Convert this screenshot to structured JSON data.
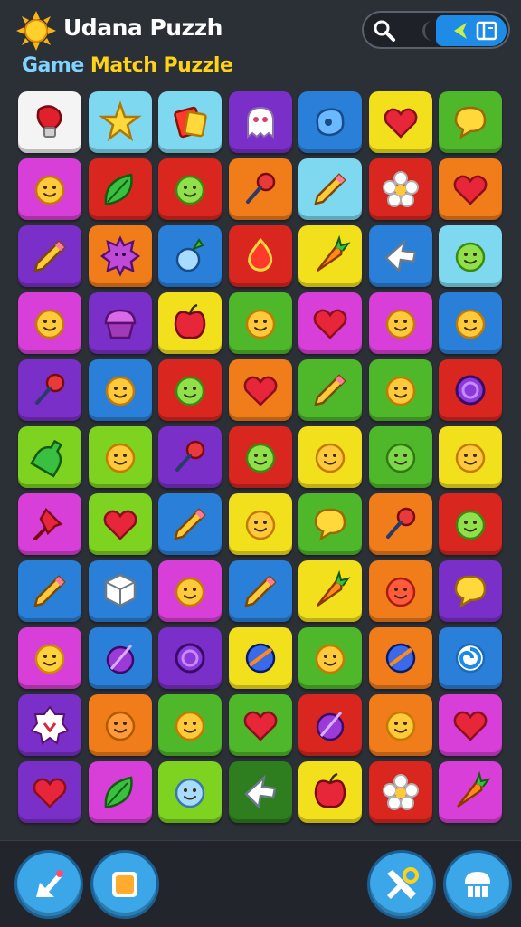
{
  "header": {
    "app_title": "Udana Puzzh",
    "subtitle_word1": "Game",
    "subtitle_word2": "Match Puzzle",
    "logo_icon": "sun-icon",
    "controls": {
      "search_icon": "search-icon",
      "toggle_icon": "moon-icon",
      "active_icons": [
        "arrow-icon",
        "book-icon"
      ]
    }
  },
  "colors": {
    "white": "#f4f4f4",
    "cyan": "#7dd8f0",
    "purple": "#7b2fc9",
    "blue": "#2a7fd8",
    "yellow": "#f2e01c",
    "green": "#4fb82a",
    "magenta": "#d83fd8",
    "red": "#d9271f",
    "orange": "#f07c1a",
    "lime": "#7ed321",
    "pink": "#f05ab4",
    "darkgreen": "#2e7d1e",
    "mint": "#8fe0d0"
  },
  "board": {
    "rows": [
      [
        {
          "bg": "white",
          "icon": "boxing-glove-icon"
        },
        {
          "bg": "cyan",
          "icon": "star-creature-icon"
        },
        {
          "bg": "cyan",
          "icon": "card-icon"
        },
        {
          "bg": "purple",
          "icon": "ghost-face-icon"
        },
        {
          "bg": "blue",
          "icon": "blob-icon"
        },
        {
          "bg": "yellow",
          "icon": "heart-icon"
        },
        {
          "bg": "green",
          "icon": "speech-bubble-icon"
        }
      ],
      [
        {
          "bg": "magenta",
          "icon": "smiley-face-icon"
        },
        {
          "bg": "red",
          "icon": "leaf-icon"
        },
        {
          "bg": "red",
          "icon": "green-smiley-icon"
        },
        {
          "bg": "orange",
          "icon": "pin-icon"
        },
        {
          "bg": "cyan",
          "icon": "pencil-icon"
        },
        {
          "bg": "red",
          "icon": "flower-icon"
        },
        {
          "bg": "orange",
          "icon": "heart-icon"
        }
      ],
      [
        {
          "bg": "purple",
          "icon": "pencil-icon"
        },
        {
          "bg": "orange",
          "icon": "gear-creature-icon"
        },
        {
          "bg": "blue",
          "icon": "turnip-icon"
        },
        {
          "bg": "red",
          "icon": "drop-icon"
        },
        {
          "bg": "yellow",
          "icon": "carrot-icon"
        },
        {
          "bg": "blue",
          "icon": "arrow-icon"
        },
        {
          "bg": "cyan",
          "icon": "green-smiley-icon"
        }
      ],
      [
        {
          "bg": "magenta",
          "icon": "smiley-face-icon"
        },
        {
          "bg": "purple",
          "icon": "cupcake-icon"
        },
        {
          "bg": "yellow",
          "icon": "apple-icon"
        },
        {
          "bg": "green",
          "icon": "smiley-face-icon"
        },
        {
          "bg": "magenta",
          "icon": "heart-icon"
        },
        {
          "bg": "magenta",
          "icon": "smiley-face-icon"
        },
        {
          "bg": "blue",
          "icon": "smiley-face-icon"
        }
      ],
      [
        {
          "bg": "purple",
          "icon": "pin-icon"
        },
        {
          "bg": "blue",
          "icon": "smiley-face-icon"
        },
        {
          "bg": "red",
          "icon": "green-smiley-icon"
        },
        {
          "bg": "orange",
          "icon": "heart-icon"
        },
        {
          "bg": "green",
          "icon": "pencil-icon"
        },
        {
          "bg": "green",
          "icon": "smiley-face-icon"
        },
        {
          "bg": "red",
          "icon": "ring-icon"
        }
      ],
      [
        {
          "bg": "lime",
          "icon": "bottle-icon"
        },
        {
          "bg": "lime",
          "icon": "winking-face-icon"
        },
        {
          "bg": "purple",
          "icon": "pin-icon"
        },
        {
          "bg": "red",
          "icon": "green-smiley-icon"
        },
        {
          "bg": "yellow",
          "icon": "smiley-face-icon"
        },
        {
          "bg": "green",
          "icon": "zombie-face-icon"
        },
        {
          "bg": "yellow",
          "icon": "smiley-face-icon"
        }
      ],
      [
        {
          "bg": "magenta",
          "icon": "pushpin-icon"
        },
        {
          "bg": "lime",
          "icon": "heart-icon"
        },
        {
          "bg": "blue",
          "icon": "pencil-icon"
        },
        {
          "bg": "yellow",
          "icon": "smiley-face-icon"
        },
        {
          "bg": "green",
          "icon": "speech-bubble-icon"
        },
        {
          "bg": "orange",
          "icon": "pin-icon"
        },
        {
          "bg": "red",
          "icon": "green-smiley-icon"
        }
      ],
      [
        {
          "bg": "blue",
          "icon": "pencil-icon"
        },
        {
          "bg": "blue",
          "icon": "cube-icon"
        },
        {
          "bg": "magenta",
          "icon": "smiley-face-icon"
        },
        {
          "bg": "blue",
          "icon": "pencil-icon"
        },
        {
          "bg": "yellow",
          "icon": "carrot-icon"
        },
        {
          "bg": "orange",
          "icon": "monster-face-icon"
        },
        {
          "bg": "purple",
          "icon": "speech-bubble-icon"
        }
      ],
      [
        {
          "bg": "magenta",
          "icon": "sun-face-icon"
        },
        {
          "bg": "blue",
          "icon": "plum-icon"
        },
        {
          "bg": "purple",
          "icon": "ring-icon"
        },
        {
          "bg": "yellow",
          "icon": "ball-icon"
        },
        {
          "bg": "green",
          "icon": "smiley-face-icon"
        },
        {
          "bg": "orange",
          "icon": "ball-icon"
        },
        {
          "bg": "blue",
          "icon": "swirl-icon"
        }
      ],
      [
        {
          "bg": "purple",
          "icon": "badge-icon"
        },
        {
          "bg": "orange",
          "icon": "bear-face-icon"
        },
        {
          "bg": "green",
          "icon": "smiley-face-icon"
        },
        {
          "bg": "green",
          "icon": "heart-icon"
        },
        {
          "bg": "red",
          "icon": "plum-icon"
        },
        {
          "bg": "orange",
          "icon": "smiley-face-icon"
        },
        {
          "bg": "magenta",
          "icon": "heart-icon"
        }
      ],
      [
        {
          "bg": "purple",
          "icon": "heart-icon"
        },
        {
          "bg": "magenta",
          "icon": "leaf-icon"
        },
        {
          "bg": "lime",
          "icon": "creature-face-icon"
        },
        {
          "bg": "darkgreen",
          "icon": "arrow-icon"
        },
        {
          "bg": "yellow",
          "icon": "apple-icon"
        },
        {
          "bg": "red",
          "icon": "flower-icon"
        },
        {
          "bg": "magenta",
          "icon": "carrot-icon"
        }
      ]
    ]
  },
  "bottom_bar": {
    "buttons": [
      {
        "icon": "back-arrow-icon"
      },
      {
        "icon": "square-icon"
      },
      {
        "icon": "shuffle-icon"
      },
      {
        "icon": "shop-icon"
      }
    ]
  }
}
